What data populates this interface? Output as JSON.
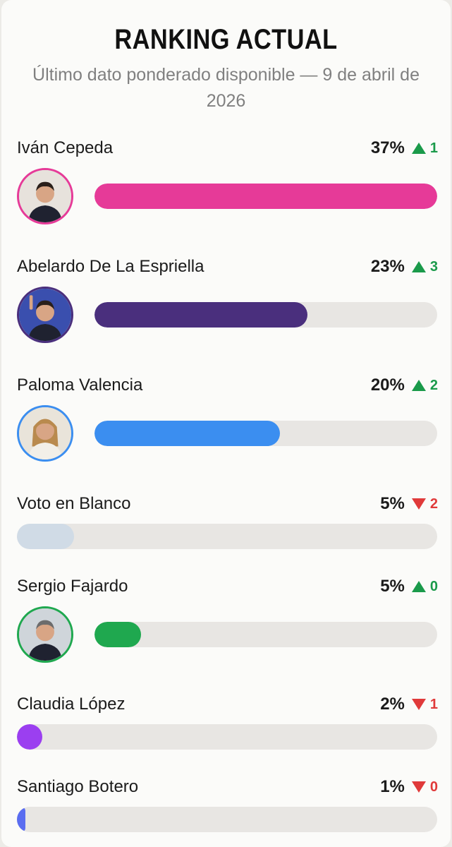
{
  "header": {
    "title": "RANKING ACTUAL",
    "subtitle": "Último dato ponderado disponible — 9 de abril de 2026"
  },
  "chart_data": {
    "type": "bar",
    "orientation": "horizontal",
    "categories": [
      "Iván Cepeda",
      "Abelardo De La Espriella",
      "Paloma Valencia",
      "Voto en Blanco",
      "Sergio Fajardo",
      "Claudia López",
      "Santiago Botero"
    ],
    "values": [
      37,
      23,
      20,
      5,
      5,
      2,
      1
    ],
    "value_labels": [
      "37%",
      "23%",
      "20%",
      "5%",
      "5%",
      "2%",
      "1%"
    ],
    "change_values": [
      1,
      3,
      2,
      2,
      0,
      1,
      0
    ],
    "change_directions": [
      "up",
      "up",
      "up",
      "down",
      "up",
      "down",
      "down"
    ],
    "xlim": [
      0,
      37
    ]
  },
  "candidates": [
    {
      "name": "Iván Cepeda",
      "pct": "37%",
      "value": 37,
      "change": "1",
      "direction": "up",
      "color": "#e63a98",
      "has_avatar": true,
      "avatar_icon": "candidate-photo-man-glasses"
    },
    {
      "name": "Abelardo De La Espriella",
      "pct": "23%",
      "value": 23,
      "change": "3",
      "direction": "up",
      "color": "#4a2f7d",
      "has_avatar": true,
      "avatar_icon": "candidate-photo-man-speech"
    },
    {
      "name": "Paloma Valencia",
      "pct": "20%",
      "value": 20,
      "change": "2",
      "direction": "up",
      "color": "#3b8ef0",
      "has_avatar": true,
      "avatar_icon": "candidate-photo-woman"
    },
    {
      "name": "Voto en Blanco",
      "pct": "5%",
      "value": 5,
      "change": "2",
      "direction": "down",
      "color": "#d0dbe6",
      "has_avatar": false
    },
    {
      "name": "Sergio Fajardo",
      "pct": "5%",
      "value": 5,
      "change": "0",
      "direction": "up",
      "color": "#1fa84f",
      "has_avatar": true,
      "avatar_icon": "candidate-photo-man-gray-hair"
    },
    {
      "name": "Claudia López",
      "pct": "2%",
      "value": 2,
      "change": "1",
      "direction": "down",
      "color": "#9b3ff0",
      "has_avatar": false
    },
    {
      "name": "Santiago Botero",
      "pct": "1%",
      "value": 1,
      "change": "0",
      "direction": "down",
      "color": "#5a6df0",
      "has_avatar": false
    }
  ],
  "colors": {
    "up": "#1a9a4a",
    "down": "#e03a3a",
    "track": "#e8e6e3"
  }
}
